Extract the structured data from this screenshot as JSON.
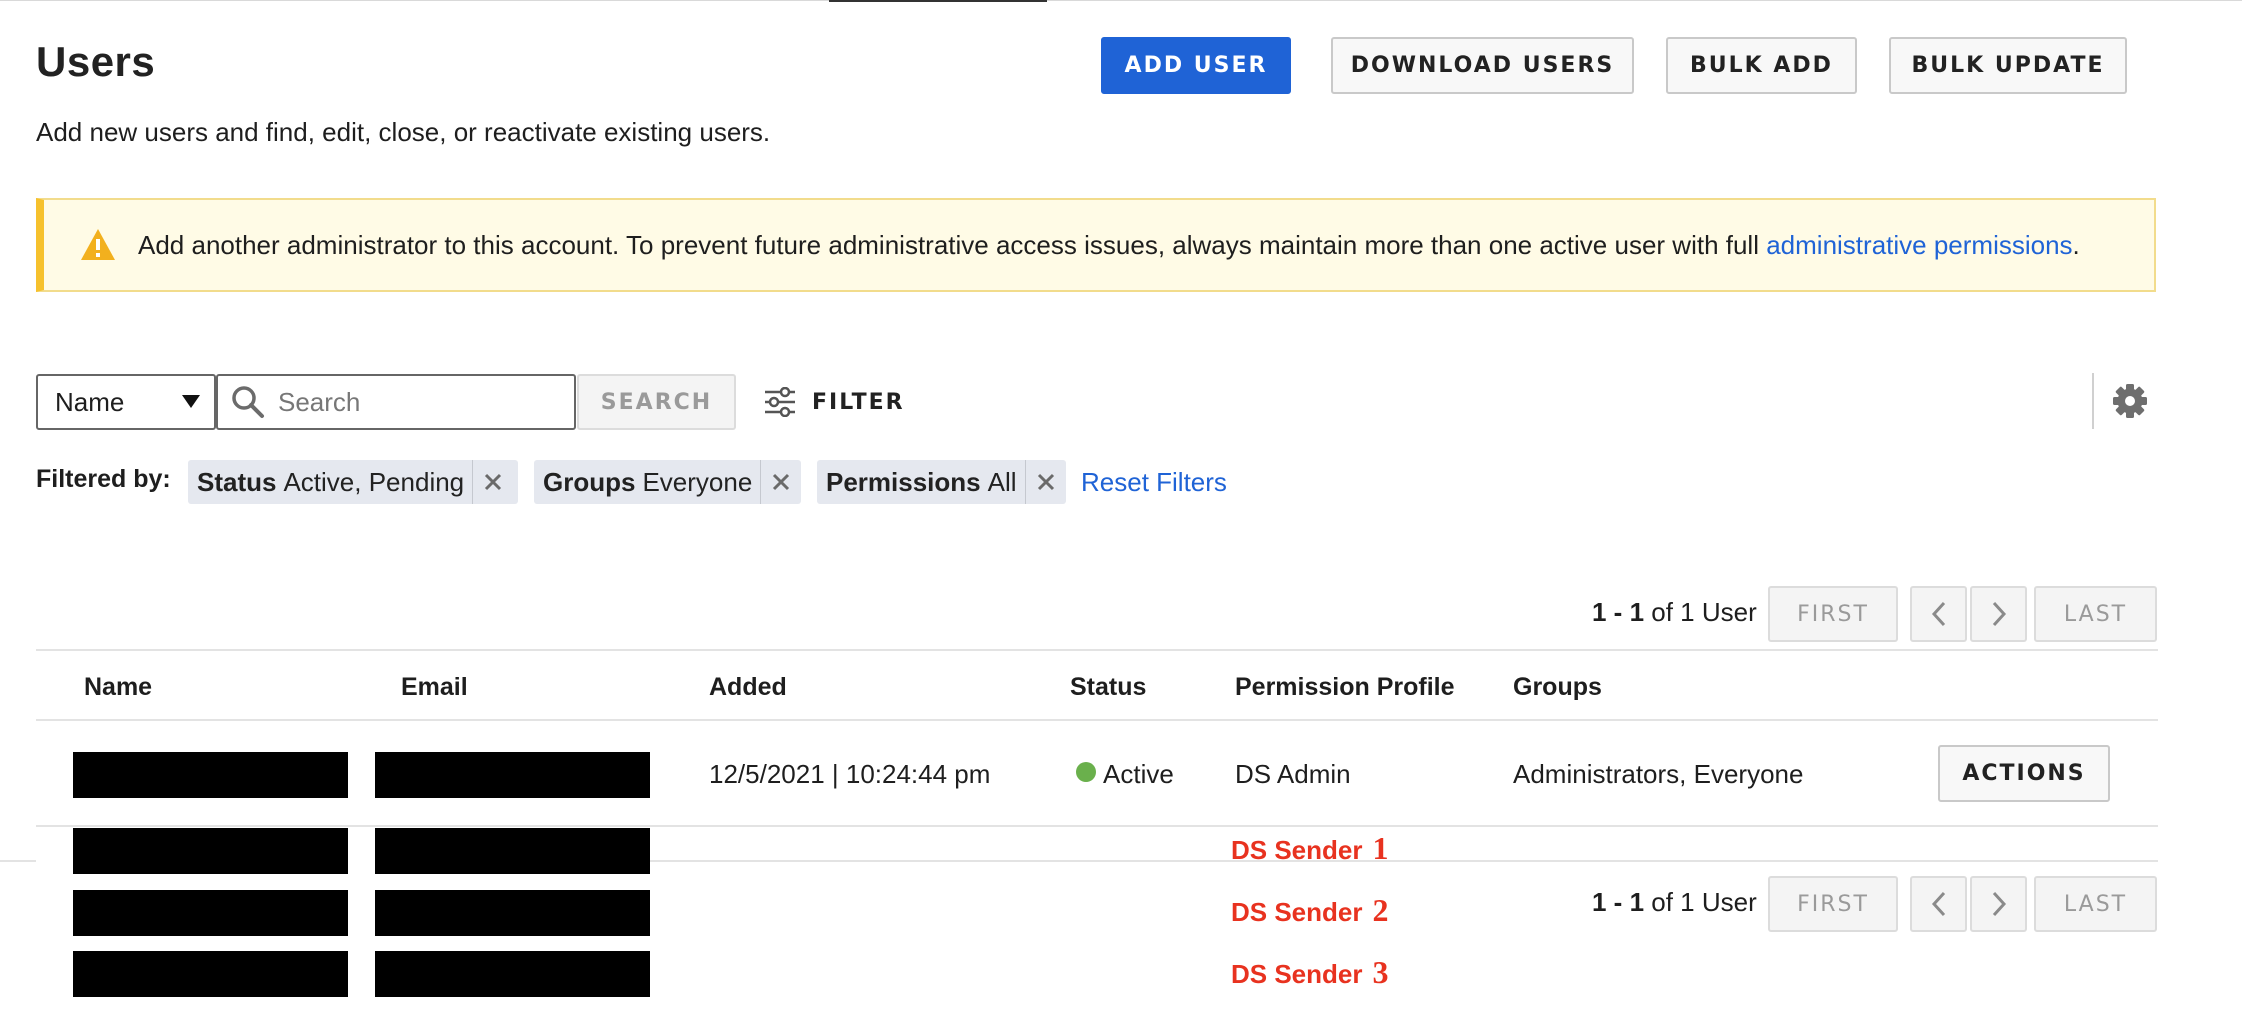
{
  "header": {
    "title": "Users",
    "subtitle": "Add new users and find, edit, close, or reactivate existing users.",
    "buttons": {
      "add_user": "ADD USER",
      "download_users": "DOWNLOAD USERS",
      "bulk_add": "BULK ADD",
      "bulk_update": "BULK UPDATE"
    }
  },
  "alert": {
    "text": "Add another administrator to this account. To prevent future administrative access issues, always maintain more than one active user with full ",
    "link": "administrative permissions",
    "end": ".",
    "icon": "warning-icon",
    "accent_color": "#f6c12d"
  },
  "search": {
    "field_select": "Name",
    "placeholder": "Search",
    "value": "",
    "button": "SEARCH",
    "filter_label": "FILTER",
    "settings_icon": "gear-icon"
  },
  "filters": {
    "label": "Filtered by:",
    "chips": [
      {
        "key": "Status",
        "value": "Active, Pending"
      },
      {
        "key": "Groups",
        "value": "Everyone"
      },
      {
        "key": "Permissions",
        "value": "All"
      }
    ],
    "reset": "Reset Filters"
  },
  "pagination": {
    "range": "1 - 1",
    "of": "of 1 User",
    "first": "FIRST",
    "last": "LAST"
  },
  "table": {
    "columns": [
      "Name",
      "Email",
      "Added",
      "Status",
      "Permission Profile",
      "Groups"
    ],
    "rows": [
      {
        "name": "",
        "email": "",
        "added": "12/5/2021 | 10:24:44 pm",
        "status": "Active",
        "permission_profile": "DS Admin",
        "groups": "Administrators, Everyone",
        "action": "ACTIONS"
      }
    ]
  },
  "annotations": [
    {
      "label": "DS Sender",
      "num": "1"
    },
    {
      "label": "DS Sender",
      "num": "2"
    },
    {
      "label": "DS Sender",
      "num": "3"
    }
  ],
  "colors": {
    "primary": "#1f63d6",
    "status_active": "#6ab04c",
    "annotation_red": "#e8321f"
  }
}
